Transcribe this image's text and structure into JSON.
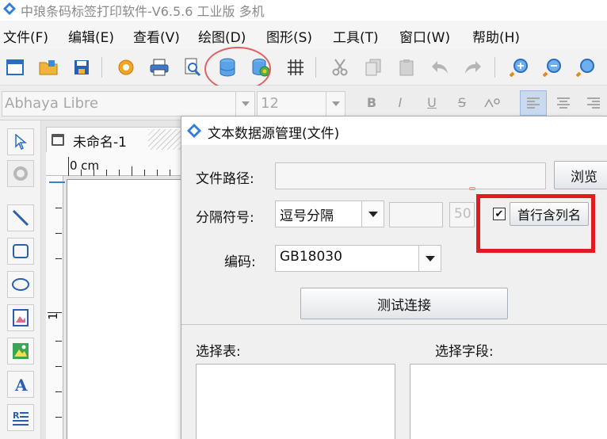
{
  "window": {
    "title": "中琅条码标签打印软件-V6.5.6 工业版 多机"
  },
  "menu": {
    "items": [
      "文件(F)",
      "编辑(E)",
      "查看(V)",
      "绘图(D)",
      "图形(S)",
      "工具(T)",
      "窗口(W)",
      "帮助(H)"
    ]
  },
  "font_toolbar": {
    "font_name": "Abhaya Libre",
    "font_size": "12",
    "bold": "B",
    "italic": "I",
    "underline": "U",
    "strike": "S"
  },
  "document": {
    "tab_title": "未命名-1",
    "ruler_h_label": "0 cm",
    "ruler_v_label": "1"
  },
  "dialog": {
    "title": "文本数据源管理(文件)",
    "file_path_label": "文件路径:",
    "file_path_value": "",
    "browse_button": "浏览",
    "separator_label": "分隔符号:",
    "separator_value": "逗号分隔",
    "separator_custom": "",
    "preview_rows": "50",
    "header_checkbox_label": "首行含列名",
    "header_checkbox_checked": true,
    "header_checkbox_mark": "✔",
    "encoding_label": "编码:",
    "encoding_value": "GB18030",
    "test_button": "测试连接",
    "select_table_label": "选择表:",
    "select_field_label": "选择字段:"
  },
  "colors": {
    "highlight_red": "#e11b22",
    "toolbar_ellipse": "#e06060",
    "accent_blue": "#3c7fd0"
  }
}
